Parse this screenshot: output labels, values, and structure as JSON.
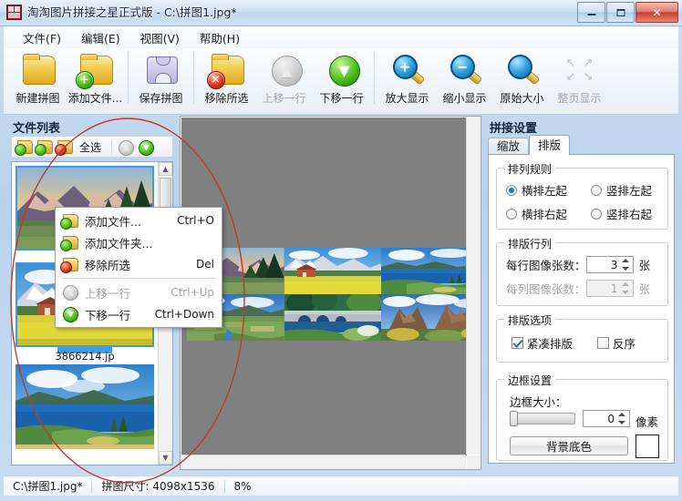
{
  "window": {
    "title": "淘淘图片拼接之星正式版 - C:\\拼图1.jpg*",
    "icon": "app-icon",
    "minimize_label": "最小化",
    "maximize_label": "最大化",
    "close_label": "关闭"
  },
  "menubar": {
    "items": [
      {
        "label": "文件(F)",
        "name": "menu-file"
      },
      {
        "label": "编辑(E)",
        "name": "menu-edit"
      },
      {
        "label": "视图(V)",
        "name": "menu-view"
      },
      {
        "label": "帮助(H)",
        "name": "menu-help"
      }
    ]
  },
  "toolbar": {
    "buttons": [
      {
        "label": "新建拼图",
        "icon": "new-collage-icon",
        "enabled": true
      },
      {
        "label": "添加文件...",
        "icon": "add-file-icon",
        "enabled": true
      },
      {
        "label": "保存拼图",
        "icon": "save-collage-icon",
        "enabled": true
      },
      {
        "label": "移除所选",
        "icon": "remove-selected-icon",
        "enabled": true
      },
      {
        "label": "上移一行",
        "icon": "move-up-icon",
        "enabled": false
      },
      {
        "label": "下移一行",
        "icon": "move-down-icon",
        "enabled": true
      },
      {
        "label": "放大显示",
        "icon": "zoom-in-icon",
        "enabled": true
      },
      {
        "label": "缩小显示",
        "icon": "zoom-out-icon",
        "enabled": true
      },
      {
        "label": "原始大小",
        "icon": "actual-size-icon",
        "enabled": true
      },
      {
        "label": "整页显示",
        "icon": "fit-page-icon",
        "enabled": false
      }
    ]
  },
  "file_list": {
    "title": "文件列表",
    "toolbar": {
      "add_file_icon": "add-file-icon",
      "add_folder_icon": "add-folder-icon",
      "remove_icon": "remove-selected-icon",
      "select_all_label": "全选",
      "move_up_icon": "move-up-icon",
      "move_down_icon": "move-down-icon"
    },
    "items": [
      {
        "name": "",
        "selected": true
      },
      {
        "name": "3866214.jp",
        "selected": true
      },
      {
        "name": "",
        "selected": false
      }
    ],
    "scrollbar": {
      "up": "▲",
      "down": "▼"
    }
  },
  "context_menu": {
    "items": [
      {
        "label": "添加文件...",
        "shortcut": "Ctrl+O",
        "icon": "add-file-icon",
        "enabled": true
      },
      {
        "label": "添加文件夹...",
        "shortcut": "",
        "icon": "add-folder-icon",
        "enabled": true
      },
      {
        "label": "移除所选",
        "shortcut": "Del",
        "icon": "remove-selected-icon",
        "enabled": true
      },
      {
        "separator": true
      },
      {
        "label": "上移一行",
        "shortcut": "Ctrl+Up",
        "icon": "move-up-icon",
        "enabled": false
      },
      {
        "label": "下移一行",
        "shortcut": "Ctrl+Down",
        "icon": "move-down-icon",
        "enabled": true
      }
    ]
  },
  "canvas": {
    "background_color": "#808080",
    "images": [
      "mountain-sunset",
      "snowy-peak-field",
      "blue-coast-golf",
      "green-valley-lake",
      "stone-bridge-garden",
      "red-rock-cliffs"
    ]
  },
  "settings": {
    "title": "拼接设置",
    "tabs": [
      {
        "label": "缩放",
        "active": false
      },
      {
        "label": "排版",
        "active": true
      }
    ],
    "arrange_rule": {
      "legend": "排列规则",
      "options": [
        {
          "label": "横排左起",
          "selected": true
        },
        {
          "label": "竖排左起",
          "selected": false
        },
        {
          "label": "横排右起",
          "selected": false
        },
        {
          "label": "竖排右起",
          "selected": false
        }
      ]
    },
    "rows_cols": {
      "legend": "排版行列",
      "per_row": {
        "label": "每行图像张数：",
        "value": "3",
        "unit": "张",
        "enabled": true
      },
      "per_col": {
        "label": "每列图像张数：",
        "value": "1",
        "unit": "张",
        "enabled": false
      }
    },
    "layout_options": {
      "legend": "排版选项",
      "compact": {
        "label": "紧凑排版",
        "checked": true
      },
      "reverse": {
        "label": "反序",
        "checked": false
      }
    },
    "border": {
      "legend": "边框设置",
      "size_label": "边框大小：",
      "size_value": "0",
      "unit": "像素",
      "bg_color_button": "背景底色",
      "bg_color_value": "#ffffff"
    }
  },
  "statusbar": {
    "file_path": "C:\\拼图1.jpg*",
    "size_label": "拼图尺寸: 4098x1536",
    "zoom": "8%"
  },
  "annotation": {
    "type": "ellipse",
    "color": "#c0392b"
  }
}
